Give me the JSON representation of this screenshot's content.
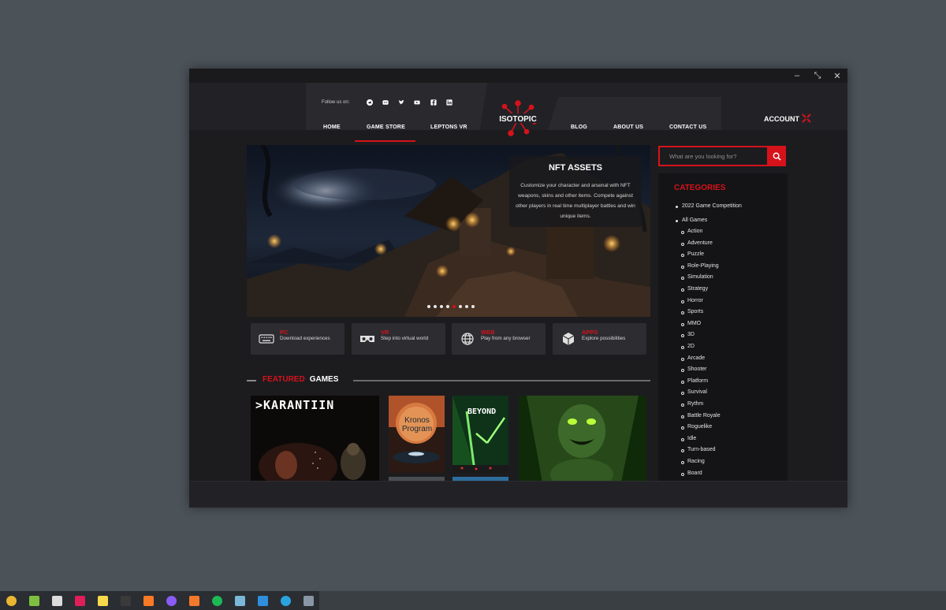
{
  "window": {
    "controls": [
      "–",
      "⤡",
      "✕"
    ]
  },
  "header": {
    "follow_label": "Follow us on:",
    "social_icons": [
      "telegram-icon",
      "discord-icon",
      "twitter-icon",
      "youtube-icon",
      "facebook-icon",
      "linkedin-icon"
    ],
    "nav_left": [
      "HOME",
      "GAME STORE",
      "LEPTONS VR"
    ],
    "nav_right": [
      "BLOG",
      "ABOUT US",
      "CONTACT US"
    ],
    "active_nav": "GAME STORE",
    "logo_text": "ISOTOPIC",
    "account_label": "ACCOUNT"
  },
  "hero": {
    "title": "NFT ASSETS",
    "description": "Customize your character and arsenal with NFT weapons, skins and other items. Compete against other players in real time multiplayer battles and win unique items.",
    "slide_count": 8,
    "active_slide": 4
  },
  "platforms": [
    {
      "title": "PC",
      "desc": "Download experiences",
      "icon": "keyboard-icon"
    },
    {
      "title": "VR",
      "desc": "Step into virtual world",
      "icon": "vr-headset-icon"
    },
    {
      "title": "WEB",
      "desc": "Play from any browser",
      "icon": "globe-icon"
    },
    {
      "title": "APPS",
      "desc": "Explore possibilities",
      "icon": "cube-icon"
    }
  ],
  "featured": {
    "title_red": "FEATURED",
    "title_white": "GAMES",
    "cards": [
      {
        "title": ">KARANTIIN"
      },
      {
        "title_line1": "Kronos",
        "title_line2": "Program"
      },
      {
        "title": "BEYOND"
      },
      {
        "title": ""
      }
    ]
  },
  "search": {
    "placeholder": "What are you looking for?"
  },
  "categories": {
    "title": "CATEGORIES",
    "top_items": [
      "2022 Game Competition",
      "All Games"
    ],
    "sub_items": [
      "Action",
      "Adventure",
      "Puzzle",
      "Role-Playing",
      "Simulation",
      "Strategy",
      "Horror",
      "Sports",
      "MMO",
      "3D",
      "2D",
      "Arcade",
      "Shooter",
      "Platform",
      "Survival",
      "Rythm",
      "Battle Royale",
      "Roguelike",
      "Idle",
      "Turn-based",
      "Racing",
      "Board"
    ]
  },
  "taskbar": {
    "apps": [
      "chrome-icon",
      "inkscape-icon",
      "unity-icon",
      "slack-icon",
      "sticky-notes-icon",
      "terminal-icon",
      "xampp-icon",
      "browser-icon",
      "blender-icon",
      "spotify-icon",
      "notepad-icon",
      "vscode-icon",
      "telegram-icon",
      "settings-icon"
    ]
  },
  "colors": {
    "accent": "#d6121b",
    "background": "#1c1c1f",
    "panel": "#141416"
  }
}
